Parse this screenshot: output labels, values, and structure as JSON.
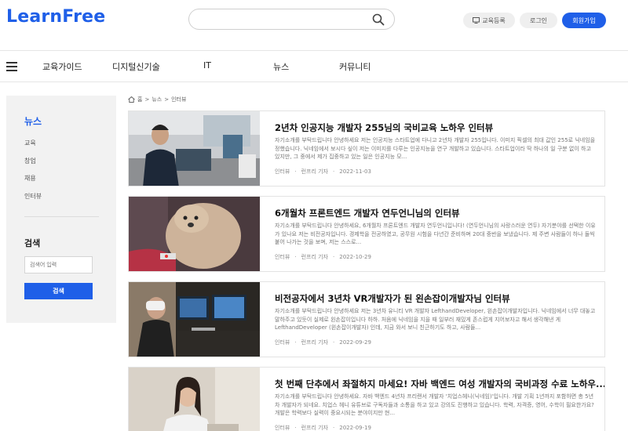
{
  "header": {
    "logo": "LearnFree",
    "search_placeholder": "",
    "course_register": "교육등록",
    "login": "로그인",
    "signup": "회원가입"
  },
  "nav": {
    "items": [
      "교육가이드",
      "디지털신기술",
      "IT",
      "뉴스",
      "커뮤니티"
    ]
  },
  "sidebar": {
    "title": "뉴스",
    "items": [
      "교육",
      "창업",
      "채용",
      "인터뷰"
    ],
    "search_title": "검색",
    "search_placeholder": "검색어 입력",
    "search_button": "검색"
  },
  "breadcrumb": {
    "home": "홈",
    "sep": ">",
    "level1": "뉴스",
    "level2": "인터뷰"
  },
  "articles": [
    {
      "title": "2년차 인공지능 개발자 255님의 국비교육 노하우 인터뷰",
      "desc": "자기소개를 부탁드립니다 안녕하세요 저는 인공지능 스타트업에 다니고 2년차 개발자 255입니다. 이미지 픽셀의 최대 값인 255로 닉네임을 정했습니다. 닉네임에서 보시다 싶이 저는 이미지를 다루는 인공지능을 연구 개발하고 있습니다. 스타트업이라 딱 하나의 일 구분 없이 하고 있지만, 그 중에서 제가 집중하고 있는 일은 인공지능 모...",
      "category": "인터뷰",
      "author": "런프리 기자",
      "date": "2022-11-03"
    },
    {
      "title": "6개월차 프론트엔드 개발자 연두언니님의 인터뷰",
      "desc": "자기소개를 부탁드립니다 안녕하세요, 6개월차 프론트엔드 개발자 연두언니입니다! (연두언니님의 사랑스러운 연두) 자기분야를 선택한 이유가 있나요 저는 비전공자입니다. 경제학을 전공하였고, 공무원 시험을 다년간 준비하며 20대 중반을 보냈습니다. 제 주변 사람들이 하나 둘씩 붙어 나가는 것을 보며, 저는 스스로...",
      "category": "인터뷰",
      "author": "런프리 기자",
      "date": "2022-10-29"
    },
    {
      "title": "비전공자에서 3년차 VR개발자가 된 왼손잡이개발자님 인터뷰",
      "desc": "자기소개를 부탁드립니다 안녕하세요 저는 3년차 유니티 VR 개발자 LefthandDeveloper, 왼손잡이개발자입니다. 닉네임에서 너무 대놓고 말하주고 있듯이 실제로 왼손잡이입니다 하하. 처음에 닉네임을 지을 때 일부러 재밌게 존스럽게 지어보자고 해서 생각해낸 게 LefthandDeveloper (왼손잡이개발자) 인데, 지금 와서 보니 친근하기도 하고, 사람들...",
      "category": "인터뷰",
      "author": "런프리 기자",
      "date": "2022-09-29"
    },
    {
      "title": "첫 번째 단추에서 좌절하지 마세요! 자바 백엔드 여성 개발자의 국비과정 수료 노하우...",
      "desc": "자기소개를 부탁드립니다 안녕하세요. 자바 백엔드 4년차 프리랜서 개발자 '치업스헤니(닉네임)'입니다. 개발 기획 1년까지 포함하면 총 5년차 개발자가 되네요. 치업스 헤니 유튜브로 구독자들과 소통을 하고 있고 강의도 진행하고 있습니다. 학력, 자격증, 영어, 수학이 필요한가요? 개발은 학력보다 실력이 중요시되는 분야이지만 현...",
      "category": "인터뷰",
      "author": "런프리 기자",
      "date": "2022-09-19"
    }
  ]
}
